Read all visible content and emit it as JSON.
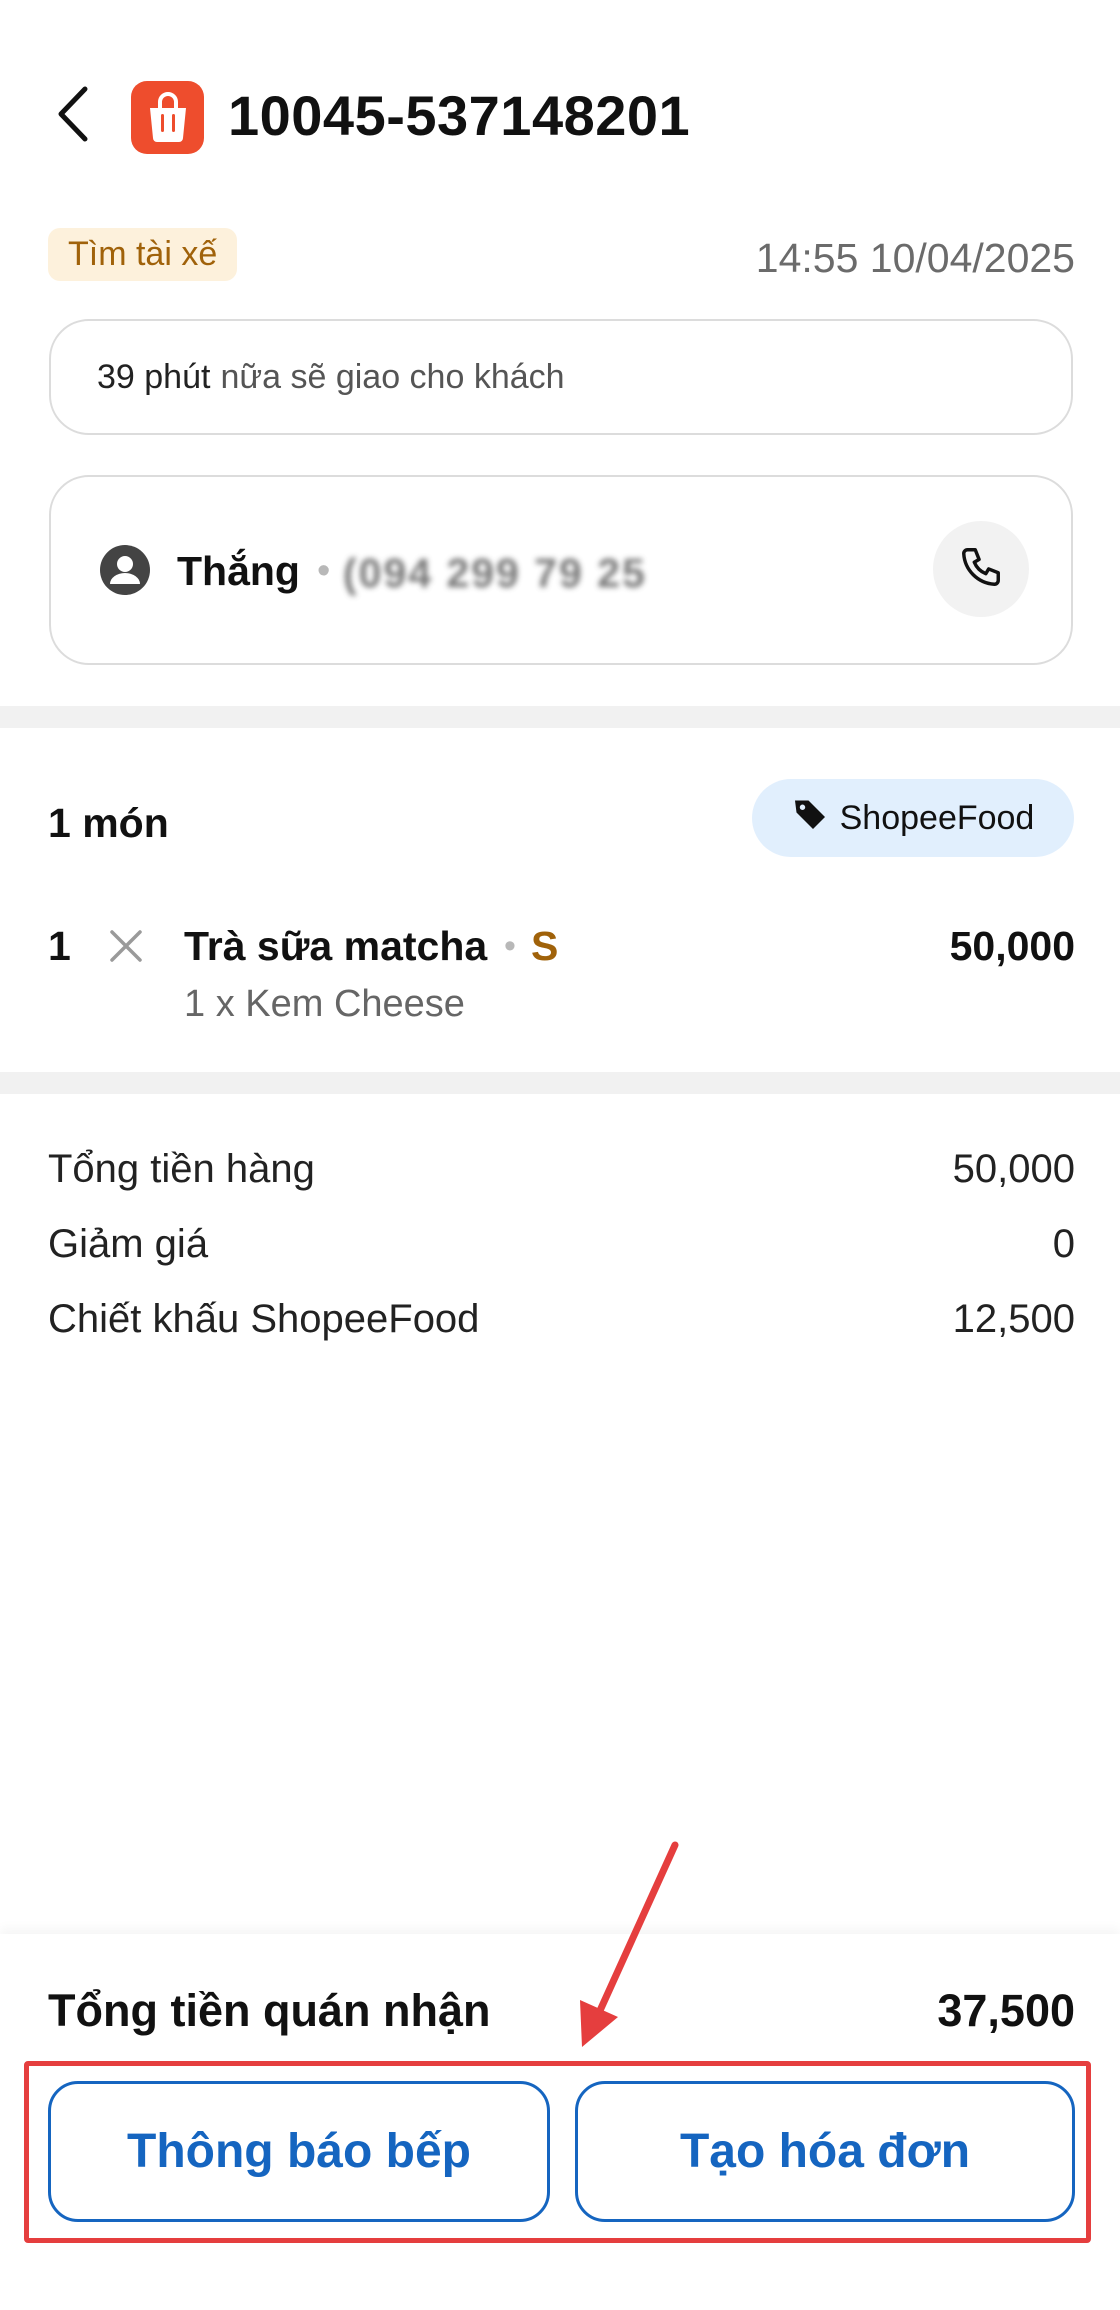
{
  "header": {
    "order_id": "10045-537148201"
  },
  "status": {
    "badge": "Tìm tài xế",
    "timestamp": "14:55 10/04/2025"
  },
  "eta": {
    "bold": "39 phút",
    "rest": "nữa sẽ giao cho khách"
  },
  "customer": {
    "name": "Thắng",
    "separator": "•",
    "phone": "(094 299 79 25"
  },
  "items": {
    "count_label": "1 món",
    "source": "ShopeeFood",
    "list": [
      {
        "qty": "1",
        "name": "Trà sữa matcha",
        "separator": "•",
        "size": "S",
        "topping": "1 x Kem Cheese",
        "price": "50,000"
      }
    ]
  },
  "summary": {
    "rows": [
      {
        "label": "Tổng tiền hàng",
        "value": "50,000"
      },
      {
        "label": "Giảm giá",
        "value": "0"
      },
      {
        "label": "Chiết khấu ShopeeFood",
        "value": "12,500"
      }
    ]
  },
  "footer": {
    "total_label": "Tổng tiền quán nhận",
    "total_value": "37,500",
    "kitchen_button": "Thông báo bếp",
    "invoice_button": "Tạo hóa đơn"
  },
  "colors": {
    "brand": "#ee4d2d",
    "accent_blue": "#1565c0",
    "badge_text": "#a0620a",
    "badge_bg": "#fdf1dc",
    "highlight_red": "#e53e3e"
  }
}
